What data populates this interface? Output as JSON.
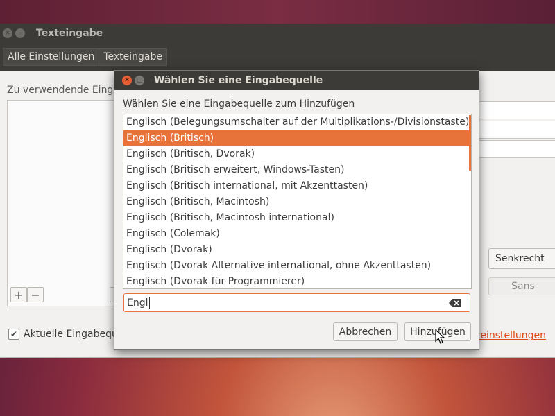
{
  "main_window": {
    "title": "Texteingabe",
    "breadcrumbs": [
      "Alle Einstellungen",
      "Texteingabe"
    ],
    "left_label": "Zu verwendende Eingab",
    "right_combo": "Senkrecht",
    "right_font_button": "Sans",
    "checkbox_label": "Aktuelle Eingabequ",
    "checkbox_checked": true,
    "right_link": "ureinstellungen"
  },
  "dialog": {
    "title": "Wählen Sie eine Eingabequelle",
    "instruction": "Wählen Sie eine Eingabequelle zum Hinzufügen",
    "items": [
      "Englisch (Belegungsumschalter auf der Multiplikations-/Divisionstaste)",
      "Englisch (Britisch)",
      "Englisch (Britisch, Dvorak)",
      "Englisch (Britisch erweitert, Windows-Tasten)",
      "Englisch (Britisch international, mit Akzenttasten)",
      "Englisch (Britisch, Macintosh)",
      "Englisch (Britisch, Macintosh international)",
      "Englisch (Colemak)",
      "Englisch (Dvorak)",
      "Englisch (Dvorak Alternative international, ohne Akzenttasten)",
      "Englisch (Dvorak für Programmierer)"
    ],
    "selected_item": "Englisch (Britisch)",
    "search_value": "Engl",
    "cancel_label": "Abbrechen",
    "add_label": "Hinzufügen"
  },
  "colors": {
    "accent": "#e8733a",
    "titlebar": "#3c3b37",
    "window_bg": "#f2f1f0",
    "link": "#dd4814"
  },
  "icons": {
    "close": "close-icon",
    "minimize": "minimize-icon",
    "add": "plus-icon",
    "remove": "minus-icon",
    "clear": "backspace-clear-icon",
    "cursor": "mouse-pointer-icon"
  }
}
